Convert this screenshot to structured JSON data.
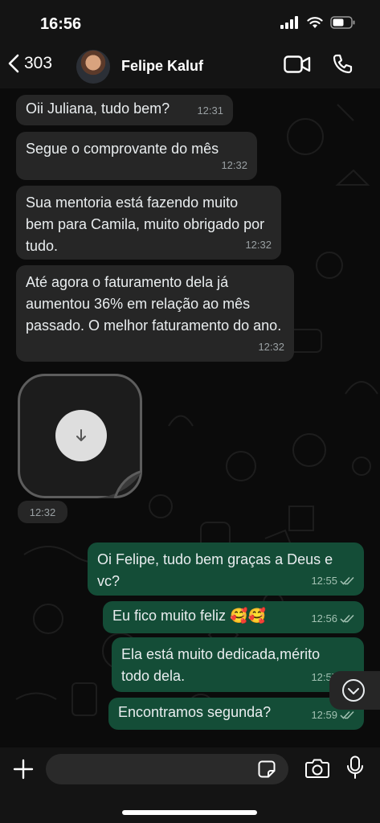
{
  "status_bar": {
    "time": "16:56"
  },
  "header": {
    "back_count": "303",
    "contact_name": "Felipe Kaluf"
  },
  "messages": [
    {
      "text": "Oii Juliana, tudo bem?",
      "time": "12:31"
    },
    {
      "text": "Segue o comprovante do mês",
      "time": "12:32"
    },
    {
      "text": "Sua mentoria está fazendo muito bem para Camila, muito obrigado por tudo.",
      "time": "12:32"
    },
    {
      "text": "Até agora o faturamento dela já aumentou 36% em relação ao mês passado. O melhor faturamento do ano.",
      "time": "12:32"
    },
    {
      "text": "Oi Felipe, tudo bem graças a Deus e vc?",
      "time": "12:55"
    },
    {
      "text": "Eu fico muito feliz 🥰🥰",
      "time": "12:56"
    },
    {
      "text": "Ela está muito dedicada,mérito todo dela.",
      "time": "12:57"
    },
    {
      "text": "Encontramos segunda?",
      "time": "12:59"
    }
  ],
  "sticker": {
    "time": "12:32"
  },
  "input": {
    "value": "",
    "placeholder": ""
  },
  "colors": {
    "incoming_bubble": "#262626",
    "outgoing_bubble": "#144d37",
    "read_ticks": "#a2c1b2"
  }
}
